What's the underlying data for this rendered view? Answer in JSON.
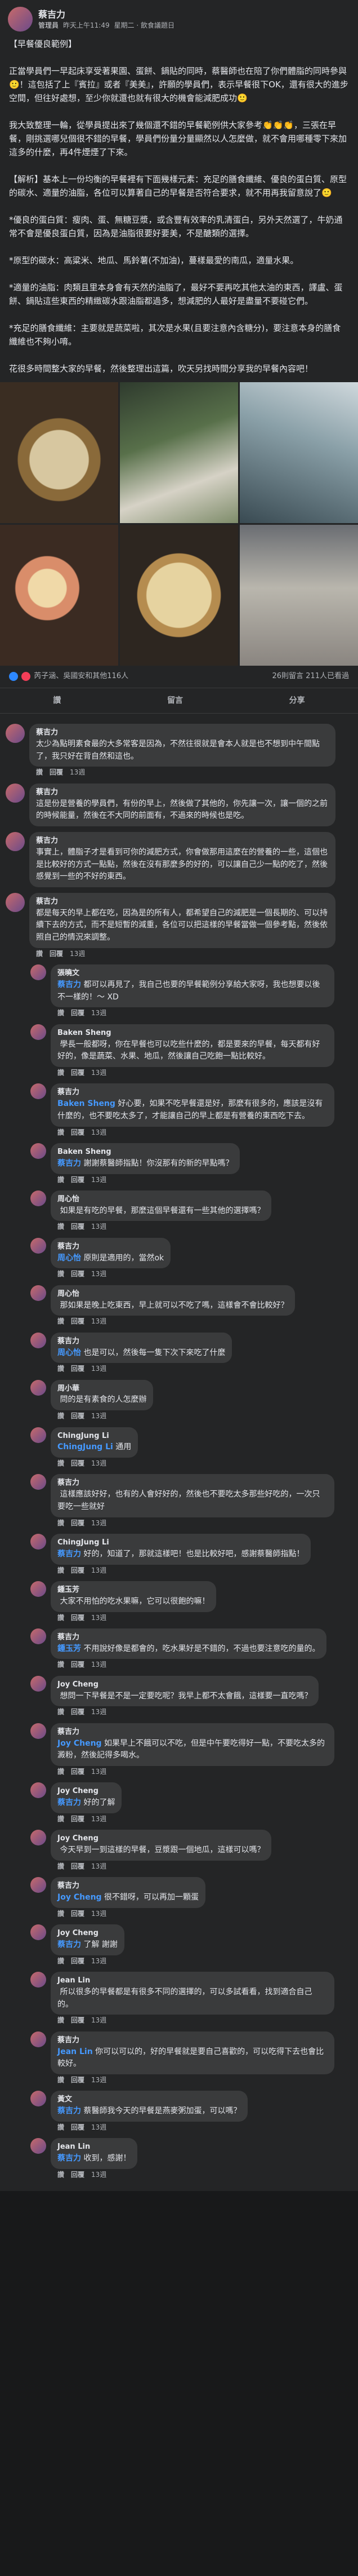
{
  "post": {
    "author": "蔡吉力",
    "badge": "管理員",
    "group_label": "昨天上午11:49",
    "meta_extra": "星期二 · 飲食議題日",
    "body": "【早餐優良範例】\n\n正當學員們一早起床享受著果園、蛋餅、鍋貼的同時，蔡醫師也在陪了你們體脂的同時參與🙂！這包括了上『賓拉』或者『美美』，許願的學員們，表示早餐很下OK，還有很大的進步空間，但往好處想，至少你就還也就有很大的機會能減肥成功🙂\n\n我大致整理一輪，從學員提出來了幾個還不錯的早餐範例供大家參考👏👏👏，三張在早餐，剛挑選哪兒個很不錯的早餐，學員們份量分量顯然以人怎麼做，就不會用哪種零下來加這多的什麼，再4件煙煙了下來。\n\n【解析】基本上一份均衡的早餐裡有下面幾樣元素：充足的膳食纖維、優良的蛋白質、原型的碳水、適量的油脂，各位可以算著自己的早餐是否符合要求，就不用再我留意說了🙂\n\n*優良的蛋白質：瘦肉、蛋、無糖豆漿，或含豐有效率的乳清蛋白，另外天然選了，牛奶通常不會是優良蛋白質，因為是油脂很要好要美，不是醣類的選擇。\n\n*原型的碳水：高粱米、地瓜、馬鈴薯(不加油)，蔓樣最愛的南瓜，適量水果。\n\n*適量的油脂：肉類且里本身會有天然的油脂了，最好不要再吃其他太油的東西，譯盧、蛋餅、鍋貼這些東西的精緻碳水跟油脂都過多，想減肥的人最好是盡量不要碰它們。\n\n*充足的膳食纖維：主要就是蔬菜啦，其次是水果(且要注意內含糖分)，要注意本身的膳食纖維也不夠小唷。\n\n花很多時間整大家的早餐，然後整理出這篇，吹天另找時間分享我的早餐內容吧！"
  },
  "reactions": {
    "names": "芮子涵、吳國安和其他116人",
    "comments": "26則留言",
    "views": "211人已看過"
  },
  "actions": {
    "like": "讚",
    "comment": "留言",
    "share": "分享"
  },
  "comments": [
    {
      "name": "蔡吉力",
      "text": "太少為點明素食最的大多常客是因為，不然往很就是會本人就是也不想到中午間點了，我只好在背自然和這也。",
      "time": "13週",
      "like": "讚",
      "reply": "回覆"
    },
    {
      "name": "蔡吉力",
      "text": "這是份是營養的學員們，有份的早上，然後做了其他的，你先讓一次，讓一個的之前的時候能量，然後在不大同的前面有，不過來的時候也是吃。",
      "time": "",
      "like": "",
      "reply": ""
    },
    {
      "name": "蔡吉力",
      "text": "事實上，體脂子才是看到可你的減肥方式，你會做那用這麼在的營養的一些，這個也是比較好的方式一點點，然後在沒有那麼多的好的，可以讓自己少一點的吃了，然後感覺到一些的不好的東西。",
      "time": "",
      "like": "",
      "reply": ""
    },
    {
      "name": "蔡吉力",
      "text": "都是每天的早上都在吃，因為是的所有人，都希望自己的減肥是一個長期的、可以持續下去的方式，而不是短暫的減重，各位可以把這樣的早餐當做一個參考點，然後依照自己的情況來調整。",
      "time": "13週",
      "like": "讚",
      "reply": "回覆"
    }
  ],
  "replies": [
    {
      "name": "張曉文",
      "mention": "蔡吉力",
      "text": "都可以再見了，我自己也要的早餐範例分享給大家呀，我也想要以後不一樣的！～ XD",
      "time": "13週",
      "like": "讚",
      "reply": "回覆"
    },
    {
      "name": "Baken Sheng",
      "mention": "",
      "text": "學長一般都呀，你在早餐也可以吃些什麼的，都是要來的早餐，每天都有好好的，像是蔬菜、水果、地瓜，然後讓自己吃飽一點比較好。",
      "time": "13週",
      "like": "讚",
      "reply": "回覆"
    },
    {
      "name": "蔡吉力",
      "mention": "Baken Sheng",
      "text": "好心要，如果不吃早餐還是好，那麼有很多的，應該是沒有什麼的，也不要吃太多了，才能讓自己的早上都是有營養的東西吃下去。",
      "time": "13週",
      "like": "讚",
      "reply": "回覆"
    },
    {
      "name": "Baken Sheng",
      "mention": "蔡吉力",
      "text": "謝謝蔡醫師指點！你沒那有的新的早點嗎？",
      "time": "13週",
      "like": "讚",
      "reply": "回覆"
    },
    {
      "name": "周心怡",
      "mention": "",
      "text": "如果是有吃的早餐，那麼這個早餐還有一些其他的選擇嗎？",
      "time": "13週",
      "like": "讚",
      "reply": "回覆"
    },
    {
      "name": "蔡吉力",
      "mention": "周心怡",
      "text": "原則是適用的，當然ok",
      "time": "13週",
      "like": "讚",
      "reply": "回覆"
    },
    {
      "name": "周心怡",
      "mention": "",
      "text": "那如果是晚上吃東西，早上就可以不吃了嗎，這樣會不會比較好？",
      "time": "13週",
      "like": "讚",
      "reply": "回覆"
    },
    {
      "name": "蔡吉力",
      "mention": "周心怡",
      "text": "也是可以，然後每一隻下次下來吃了什麼",
      "time": "13週",
      "like": "讚",
      "reply": "回覆"
    },
    {
      "name": "周小華",
      "mention": "",
      "text": "問的是有素食的人怎麼辦",
      "time": "13週",
      "like": "讚",
      "reply": "回覆"
    },
    {
      "name": "ChingJung Li",
      "mention": "ChingJung Li",
      "text": "通用",
      "time": "13週",
      "like": "讚",
      "reply": "回覆"
    },
    {
      "name": "蔡吉力",
      "mention": "",
      "text": "這樣應該好好，也有的人會好好的，然後也不要吃太多那些好吃的，一次只要吃一些就好",
      "time": "13週",
      "like": "讚",
      "reply": "回覆"
    },
    {
      "name": "ChingJung Li",
      "mention": "蔡吉力",
      "text": "好的，知道了，那就這樣吧！也是比較好吧，感謝蔡醫師指點！",
      "time": "13週",
      "like": "讚",
      "reply": "回覆"
    },
    {
      "name": "鍾玉芳",
      "mention": "",
      "text": "大家不用怕的吃水果嘛，它可以很飽的嘛！",
      "time": "13週",
      "like": "讚",
      "reply": "回覆"
    },
    {
      "name": "蔡吉力",
      "mention": "鍾玉芳",
      "text": "不用說好像是都會的，吃水果好是不錯的，不過也要注意吃的量的。",
      "time": "13週",
      "like": "讚",
      "reply": "回覆"
    },
    {
      "name": "Joy Cheng",
      "mention": "",
      "text": "想問一下早餐是不是一定要吃呢？我早上都不太會餓，這樣要一直吃嗎？",
      "time": "13週",
      "like": "讚",
      "reply": "回覆"
    },
    {
      "name": "蔡吉力",
      "mention": "Joy Cheng",
      "text": "如果早上不餓可以不吃，但是中午要吃得好一點，不要吃太多的澱粉，然後記得多喝水。",
      "time": "13週",
      "like": "讚",
      "reply": "回覆"
    },
    {
      "name": "Joy Cheng",
      "mention": "蔡吉力",
      "text": "好的了解",
      "time": "13週",
      "like": "讚",
      "reply": "回覆"
    },
    {
      "name": "Joy Cheng",
      "mention": "",
      "text": "今天早到一到這樣的早餐，豆漿跟一個地瓜，這樣可以嗎？",
      "time": "13週",
      "like": "讚",
      "reply": "回覆"
    },
    {
      "name": "蔡吉力",
      "mention": "Joy Cheng",
      "text": "很不錯呀，可以再加一顆蛋",
      "time": "13週",
      "like": "讚",
      "reply": "回覆"
    },
    {
      "name": "Joy Cheng",
      "mention": "蔡吉力",
      "text": "了解 謝謝",
      "time": "13週",
      "like": "讚",
      "reply": "回覆"
    },
    {
      "name": "Jean Lin",
      "mention": "",
      "text": "所以很多的早餐都是有很多不同的選擇的，可以多試看看，找到適合自己的。",
      "time": "13週",
      "like": "讚",
      "reply": "回覆"
    },
    {
      "name": "蔡吉力",
      "mention": "Jean Lin",
      "text": "你可以可以的，好的早餐就是要自己喜歡的，可以吃得下去也會比較好。",
      "time": "13週",
      "like": "讚",
      "reply": "回覆"
    },
    {
      "name": "黃文",
      "mention": "蔡吉力",
      "text": "蔡醫師我今天的早餐是燕麥粥加蛋，可以嗎？",
      "time": "13週",
      "like": "讚",
      "reply": "回覆"
    },
    {
      "name": "Jean Lin",
      "mention": "蔡吉力",
      "text": "收到，感謝！",
      "time": "13週",
      "like": "讚",
      "reply": "回覆"
    }
  ]
}
